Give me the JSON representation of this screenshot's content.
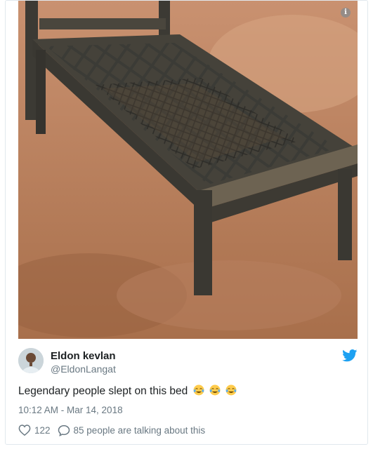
{
  "tweet": {
    "author_name": "Eldon kevlan",
    "author_handle": "@EldonLangat",
    "text": "Legendary people slept on this bed",
    "emoji": [
      "tears-of-joy-emoji",
      "tears-of-joy-emoji",
      "tears-of-joy-emoji"
    ],
    "timestamp": "10:12 AM - Mar 14, 2018",
    "likes": "122",
    "replies": "85 people are talking about this",
    "media_alt": "photo of a worn wooden bed frame with broken woven straps outdoors"
  },
  "icons": {
    "info": "info-icon",
    "brand": "twitter-bird-icon",
    "like": "heart-icon",
    "reply": "speech-bubble-icon"
  },
  "colors": {
    "brand_blue": "#1da1f2",
    "text_primary": "#1c2022",
    "text_secondary": "#697882",
    "border": "#e1e8ed"
  }
}
